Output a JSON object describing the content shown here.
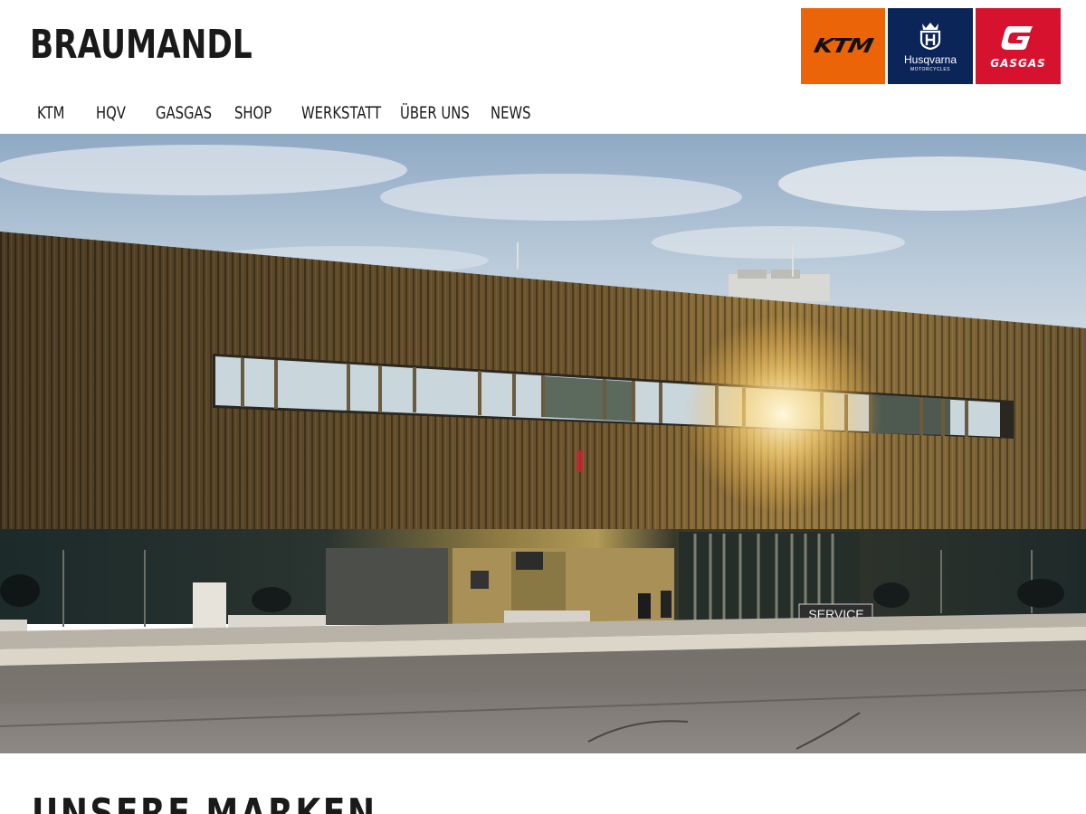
{
  "site": {
    "logo_text": "BRAUMANDL"
  },
  "brands": [
    {
      "name": "KTM",
      "label": "KTM",
      "color": "#ec6408"
    },
    {
      "name": "Husqvarna",
      "label": "Husqvarna",
      "sub": "MOTORCYCLES",
      "color": "#0b2559"
    },
    {
      "name": "GASGAS",
      "label": "GASGAS",
      "color": "#d6122e"
    }
  ],
  "nav": {
    "items": [
      {
        "label": "KTM"
      },
      {
        "label": "HQV"
      },
      {
        "label": "GASGAS"
      },
      {
        "label": "SHOP"
      },
      {
        "label": "WERKSTATT"
      },
      {
        "label": "ÜBER UNS"
      },
      {
        "label": "NEWS"
      }
    ]
  },
  "hero": {
    "sign_text": "SERVICE"
  },
  "section": {
    "title": "UNSERE MARKEN"
  }
}
